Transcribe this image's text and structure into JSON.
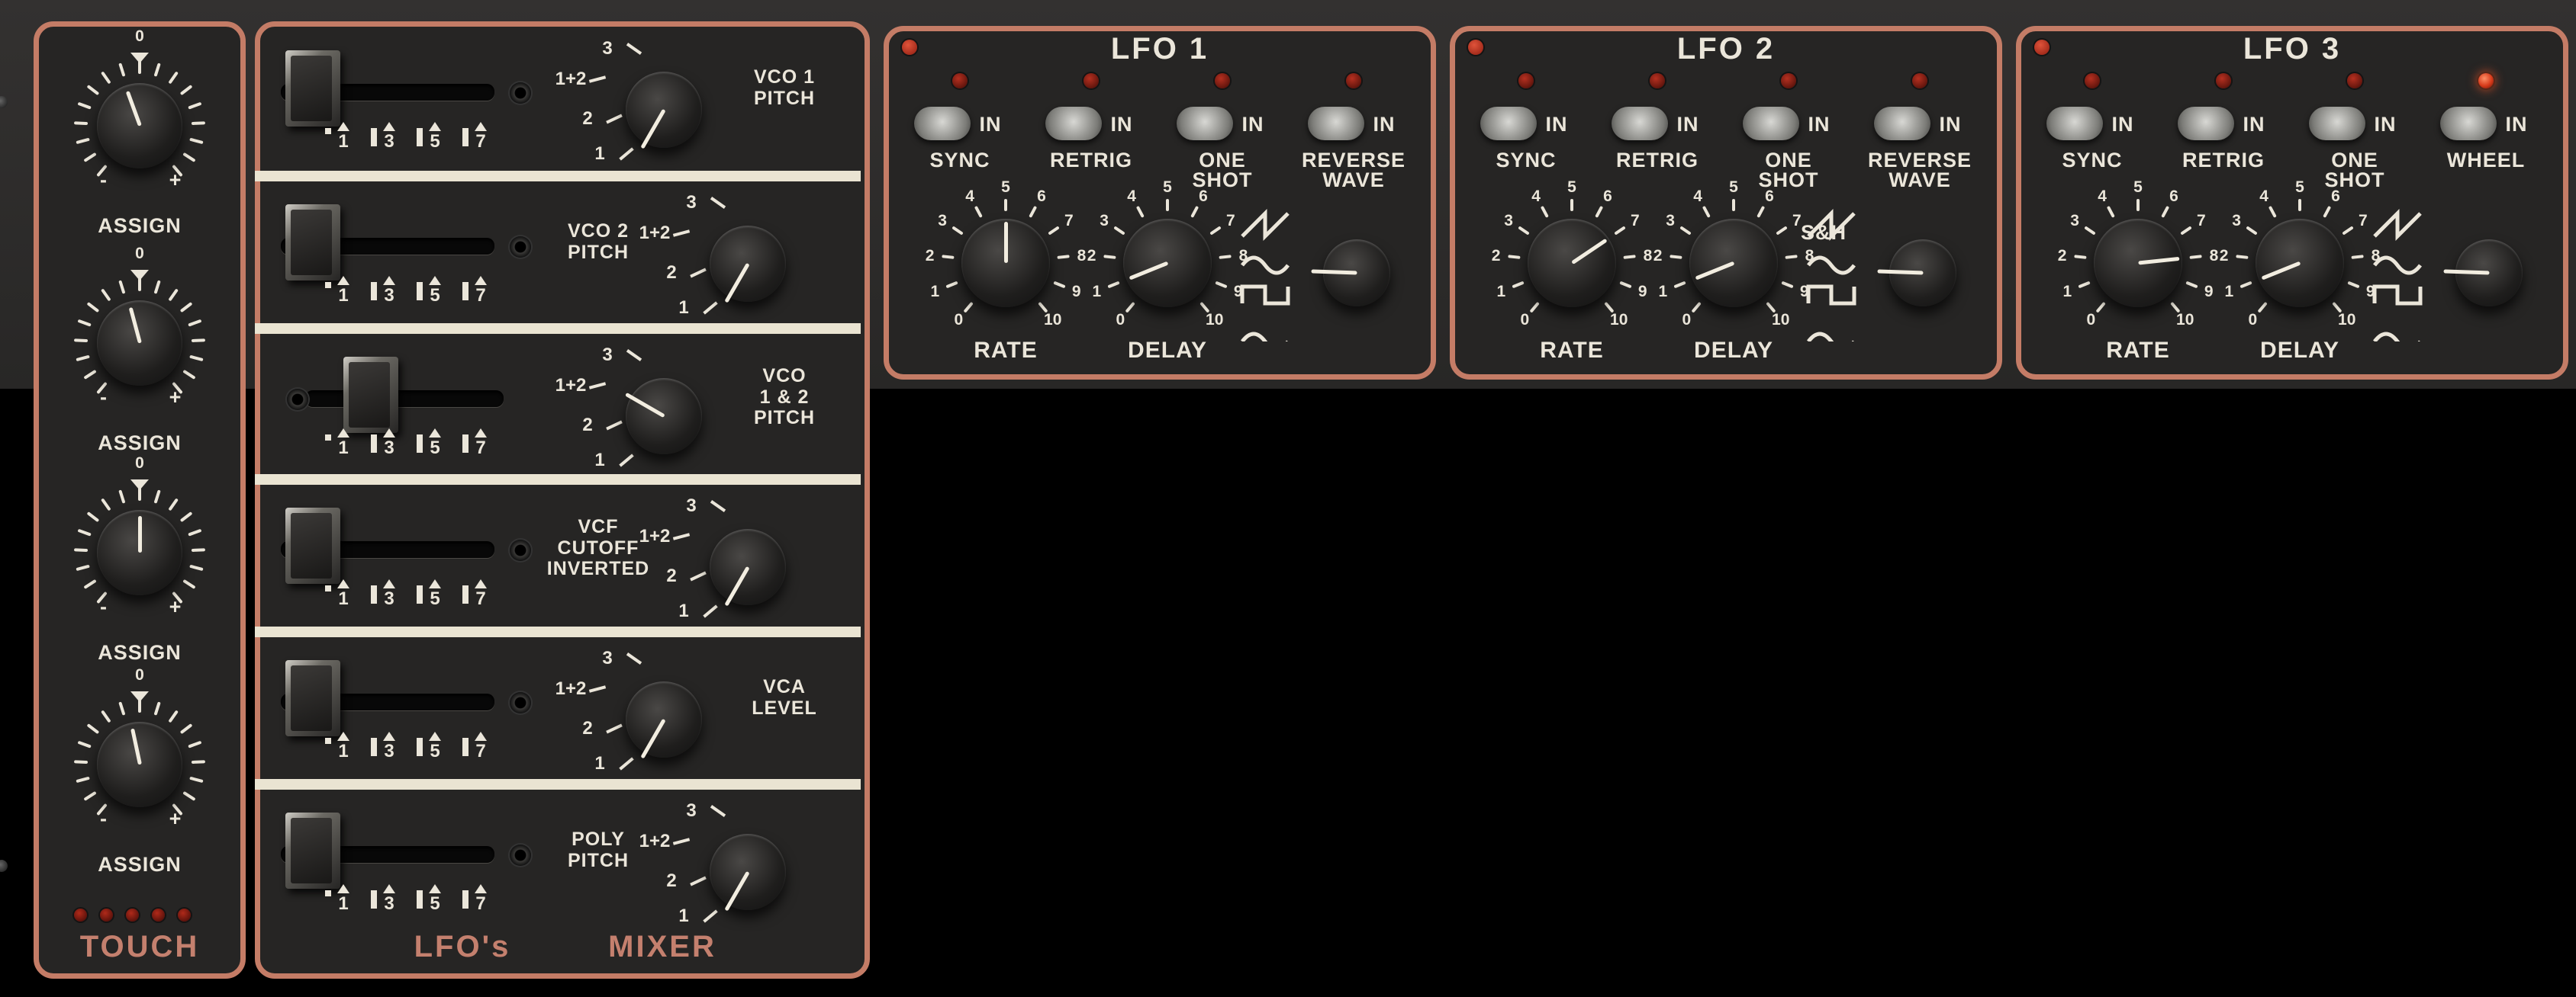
{
  "touch": {
    "title": "TOUCH",
    "assign_labels": [
      "ASSIGN",
      "ASSIGN",
      "ASSIGN",
      "ASSIGN"
    ],
    "minus": "-",
    "plus": "+",
    "zero": "0"
  },
  "mixer": {
    "left_title": "LFO's",
    "right_title": "MIXER",
    "scale_numbers": [
      "1",
      "3",
      "5",
      "7"
    ],
    "switch_positions": [
      "3",
      "1+2",
      "2",
      "1"
    ],
    "channels": [
      {
        "label": "VCO 1\nPITCH",
        "switch": "1"
      },
      {
        "label": "VCO 2\nPITCH",
        "switch": "1"
      },
      {
        "label": "VCO\n1 & 2\nPITCH",
        "switch": "3"
      },
      {
        "label": "VCF\nCUTOFF\nINVERTED",
        "switch": "1"
      },
      {
        "label": "VCA\nLEVEL",
        "switch": "1"
      },
      {
        "label": "POLY\nPITCH",
        "switch": "1"
      }
    ]
  },
  "lfo_common": {
    "rate_label": "RATE",
    "delay_label": "DELAY",
    "in_label": "IN",
    "scale": [
      "0",
      "1",
      "2",
      "3",
      "4",
      "5",
      "6",
      "7",
      "8",
      "9",
      "10"
    ],
    "sh_label": "S&H"
  },
  "lfos": [
    {
      "title": "LFO 1",
      "switches": [
        {
          "label": "SYNC",
          "state": "off"
        },
        {
          "label": "RETRIG",
          "state": "off"
        },
        {
          "label": "ONE\nSHOT",
          "state": "off"
        },
        {
          "label": "REVERSE\nWAVE",
          "state": "off"
        }
      ],
      "rate": 5,
      "delay": 1
    },
    {
      "title": "LFO 2",
      "switches": [
        {
          "label": "SYNC",
          "state": "off"
        },
        {
          "label": "RETRIG",
          "state": "off"
        },
        {
          "label": "ONE\nSHOT",
          "state": "off"
        },
        {
          "label": "REVERSE\nWAVE",
          "state": "off"
        }
      ],
      "rate": 7,
      "delay": 1
    },
    {
      "title": "LFO 3",
      "switches": [
        {
          "label": "SYNC",
          "state": "off"
        },
        {
          "label": "RETRIG",
          "state": "off"
        },
        {
          "label": "ONE\nSHOT",
          "state": "off"
        },
        {
          "label": "WHEEL",
          "state": "on"
        }
      ],
      "rate": 8,
      "delay": 1
    }
  ],
  "colors": {
    "panel_border": "#c47c66",
    "panel_bg": "#262524",
    "text": "#ebe6da",
    "led_on": "#ff5a28"
  }
}
